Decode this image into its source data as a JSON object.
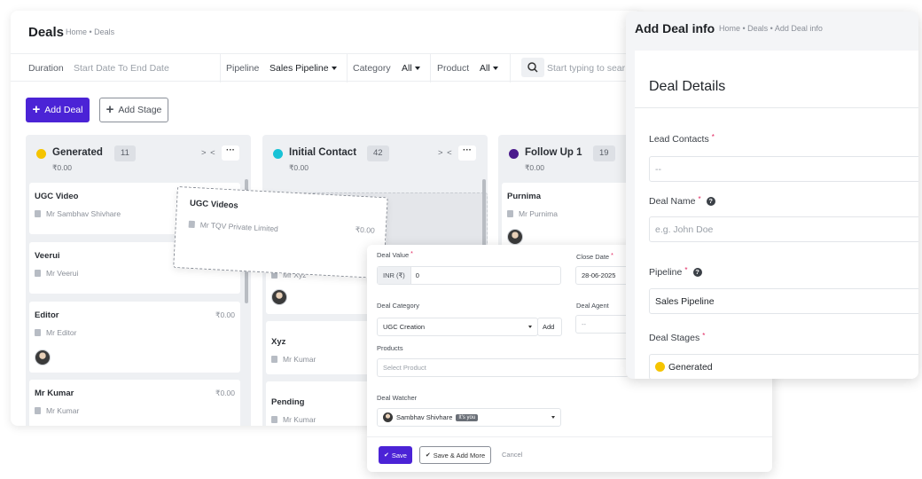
{
  "main": {
    "title": "Deals",
    "breadcrumb": "Home • Deals",
    "filters": {
      "duration_label": "Duration",
      "duration_placeholder": "Start Date To End Date",
      "pipeline_label": "Pipeline",
      "pipeline_value": "Sales Pipeline",
      "category_label": "Category",
      "category_value": "All",
      "product_label": "Product",
      "product_value": "All",
      "search_placeholder": "Start typing to sear"
    },
    "add_deal_label": "Add Deal",
    "add_stage_label": "Add Stage",
    "columns": [
      {
        "title": "Generated",
        "count": "11",
        "amount": "₹0.00",
        "color": "#f5c400",
        "cards": [
          {
            "name": "UGC Video",
            "contact": "Mr Sambhav Shivhare",
            "amount": ""
          },
          {
            "name": "Veerui",
            "contact": "Mr Veerui",
            "amount": ""
          },
          {
            "name": "Editor",
            "contact": "Mr Editor",
            "amount": "₹0.00"
          },
          {
            "name": "Mr Kumar",
            "contact": "Mr Kumar",
            "amount": "₹0.00"
          }
        ]
      },
      {
        "title": "Initial Contact",
        "count": "42",
        "amount": "₹0.00",
        "color": "#18c2d6",
        "cards": [
          {
            "name": "",
            "contact": "Mr Xyz",
            "amount": ""
          },
          {
            "name": "Xyz",
            "contact": "Mr Kumar",
            "amount": ""
          },
          {
            "name": "Pending",
            "contact": "Mr Kumar",
            "amount": ""
          }
        ]
      },
      {
        "title": "Follow Up 1",
        "count": "19",
        "amount": "₹0.00",
        "color": "#4a1a8c",
        "cards": [
          {
            "name": "Purnima",
            "contact": "Mr Purnima",
            "amount": ""
          }
        ]
      }
    ],
    "dragging_card": {
      "name": "UGC Videos",
      "contact": "Mr TQV Private Limited",
      "amount": "₹0.00"
    }
  },
  "form": {
    "deal_value_label": "Deal Value",
    "currency_prefix": "INR (₹)",
    "deal_value": "0",
    "close_date_label": "Close Date",
    "close_date": "28-06-2025",
    "deal_category_label": "Deal Category",
    "deal_category": "UGC Creation",
    "add_label": "Add",
    "deal_agent_label": "Deal Agent",
    "deal_agent_placeholder": "--",
    "products_label": "Products",
    "products_placeholder": "Select Product",
    "deal_watcher_label": "Deal Watcher",
    "deal_watcher": "Sambhav Shivhare",
    "you_badge": "It's you",
    "save_label": "Save",
    "save_more_label": "Save & Add More",
    "cancel_label": "Cancel"
  },
  "side": {
    "title": "Add Deal info",
    "breadcrumb": "Home • Deals • Add Deal info",
    "section_title": "Deal Details",
    "lead_contacts_label": "Lead Contacts",
    "lead_contacts_value": "--",
    "deal_name_label": "Deal Name",
    "deal_name_placeholder": "e.g. John Doe",
    "pipeline_label": "Pipeline",
    "pipeline_value": "Sales Pipeline",
    "deal_stages_label": "Deal Stages",
    "deal_stage_value": "Generated",
    "deal_stage_color": "#f5c400"
  },
  "accent_color": "#4b23d6"
}
